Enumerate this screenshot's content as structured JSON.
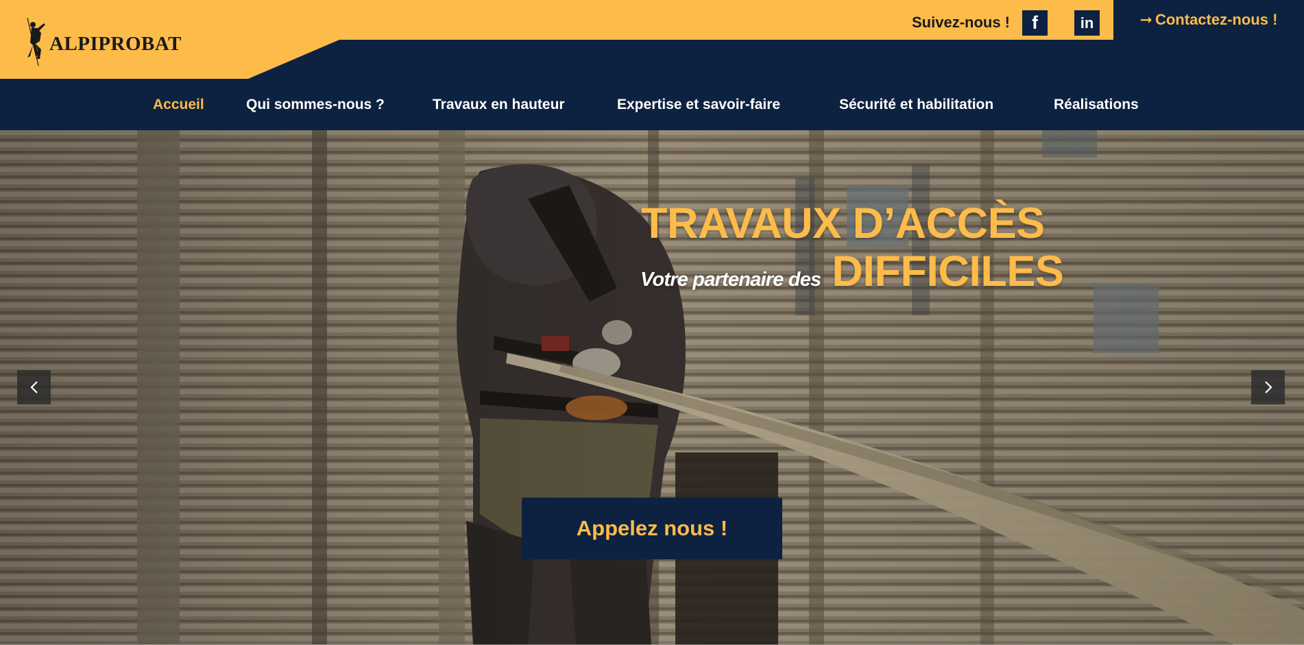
{
  "header": {
    "brand": "ALPIPROBAT",
    "follow_label": "Suivez-nous !",
    "social": {
      "facebook_label": "f",
      "linkedin_label": "in"
    },
    "contact": {
      "arrow": "➞",
      "label": "Contactez-nous !"
    }
  },
  "nav": {
    "items": [
      {
        "label": "Accueil",
        "active": true
      },
      {
        "label": "Qui sommes-nous ?",
        "active": false
      },
      {
        "label": "Travaux en hauteur",
        "active": false
      },
      {
        "label": "Expertise et savoir-faire",
        "active": false
      },
      {
        "label": "Sécurité et habilitation",
        "active": false
      },
      {
        "label": "Réalisations",
        "active": false
      }
    ]
  },
  "hero": {
    "headline": "TRAVAUX D’ACCÈS",
    "tagline": "Votre partenaire des",
    "headline_2": "DIFFICILES",
    "cta_label": "Appelez nous !"
  },
  "colors": {
    "navy": "#0d2240",
    "accent_yellow": "#fdbb4a",
    "white": "#ffffff"
  },
  "icons": {
    "prev": "chevron-left-icon",
    "next": "chevron-right-icon",
    "facebook": "facebook-icon",
    "linkedin": "linkedin-icon",
    "logo": "climber-logo-icon"
  }
}
